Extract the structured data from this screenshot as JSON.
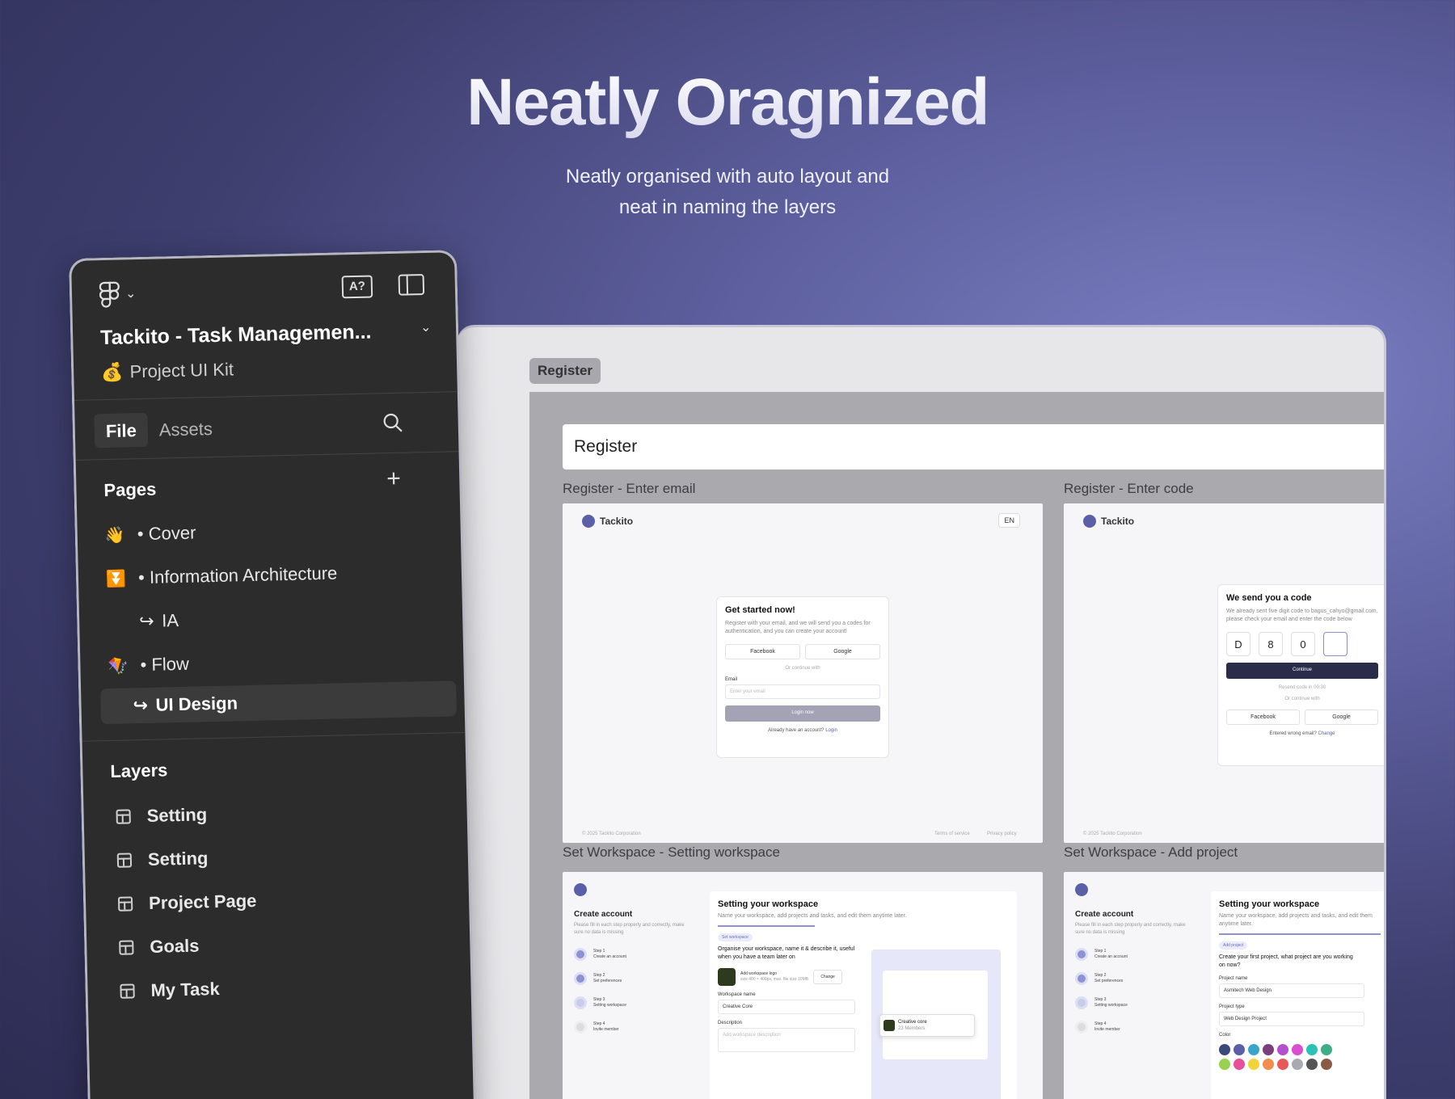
{
  "hero": {
    "title": "Neatly Oragnized",
    "subtitle_line1": "Neatly organised with auto layout and",
    "subtitle_line2": "neat in naming the layers"
  },
  "panel": {
    "project_title": "Tackito - Task Managemen...",
    "project_subtitle": "Project UI Kit",
    "project_subtitle_emoji": "💰",
    "translate_icon_label": "A?",
    "tabs": {
      "file": "File",
      "assets": "Assets"
    },
    "pages_heading": "Pages",
    "pages": [
      {
        "emoji": "👋",
        "label": "Cover"
      },
      {
        "emoji": "⏬",
        "label": "Information Architecture"
      },
      {
        "sub": true,
        "arrow": "↪",
        "label": "IA"
      },
      {
        "emoji": "🪁",
        "label": "Flow"
      },
      {
        "sub": true,
        "arrow": "↪",
        "label": "UI Design",
        "selected": true
      }
    ],
    "layers_heading": "Layers",
    "layers": [
      "Setting",
      "Setting",
      "Project Page",
      "Goals",
      "My Task"
    ]
  },
  "canvas": {
    "frame_tag": "Register",
    "board_title": "Register",
    "sections": {
      "enter_email": "Register - Enter email",
      "enter_code": "Register - Enter code",
      "set_workspace": "Set Workspace - Setting workspace",
      "add_project": "Set Workspace - Add project"
    },
    "brand": "Tackito",
    "lang": "EN",
    "email_card": {
      "title": "Get started now!",
      "desc": "Register with your email, and we will send you a codes for authentication, and you can create your account!",
      "facebook": "Facebook",
      "google": "Google",
      "or": "Or continue with",
      "email_label": "Email",
      "email_placeholder": "Enter your email",
      "login_btn": "Login now",
      "have_account": "Already have an account?",
      "login_link": "Login"
    },
    "code_card": {
      "title": "We send you a code",
      "desc": "We already sent five digit code to bagus_cahyo@gmail.com, please check your email and enter the code below",
      "digits": [
        "D",
        "8",
        "0",
        ""
      ],
      "continue_btn": "Continue",
      "resend": "Resend code in 00:30",
      "or": "Or continue with",
      "facebook": "Facebook",
      "google": "Google",
      "wrong_email": "Entered wrong email?",
      "change": "Change"
    },
    "footer_copy": "© 2025 Tackito Corporation",
    "footer_terms": "Terms of service",
    "footer_privacy": "Privacy policy",
    "steps": {
      "title": "Create account",
      "desc": "Please fill in each step properly and correctly, make sure no data is missing",
      "items": [
        {
          "step": "Step 1",
          "label": "Create an account"
        },
        {
          "step": "Step 2",
          "label": "Set preferences"
        },
        {
          "step": "Step 3",
          "label": "Setting workspace"
        },
        {
          "step": "Step 4",
          "label": "Invite member"
        }
      ]
    },
    "workspace_card": {
      "title": "Setting your workspace",
      "desc": "Name your workspace, add projects and tasks, and edit them anytime later.",
      "pill": "Set workspace",
      "prompt": "Organise your workspace, name it & describe it, useful when you have a team later on",
      "logo_label": "Add workspace logo",
      "logo_hint": "size 400 × 400px, max. file size 10MB",
      "change": "Change",
      "name_label": "Workspace name",
      "name_value": "Creative Core",
      "desc_label": "Description",
      "desc_placeholder": "Add workspace description",
      "preview_name": "Creative core",
      "preview_members": "23 Members"
    },
    "project_card": {
      "title": "Setting your workspace",
      "desc": "Name your workspace, add projects and tasks, and edit them anytime later.",
      "pill": "Add project",
      "prompt": "Create your first project, what project are you working on now?",
      "name_label": "Project name",
      "name_value": "Asmitech Web Design",
      "type_label": "Project type",
      "type_value": "Web Design Project",
      "color_label": "Color"
    },
    "swatch_colors": [
      "#3b4a7a",
      "#5b5fa8",
      "#3aa6c7",
      "#7a3f7a",
      "#b44fd1",
      "#d94fd1",
      "#2bc1b5",
      "#3fae86",
      "#9ad14f",
      "#e94f9a",
      "#f2d43a",
      "#f28d4f",
      "#e8585a",
      "#a9a9b1",
      "#555",
      "#8a5a44"
    ]
  }
}
